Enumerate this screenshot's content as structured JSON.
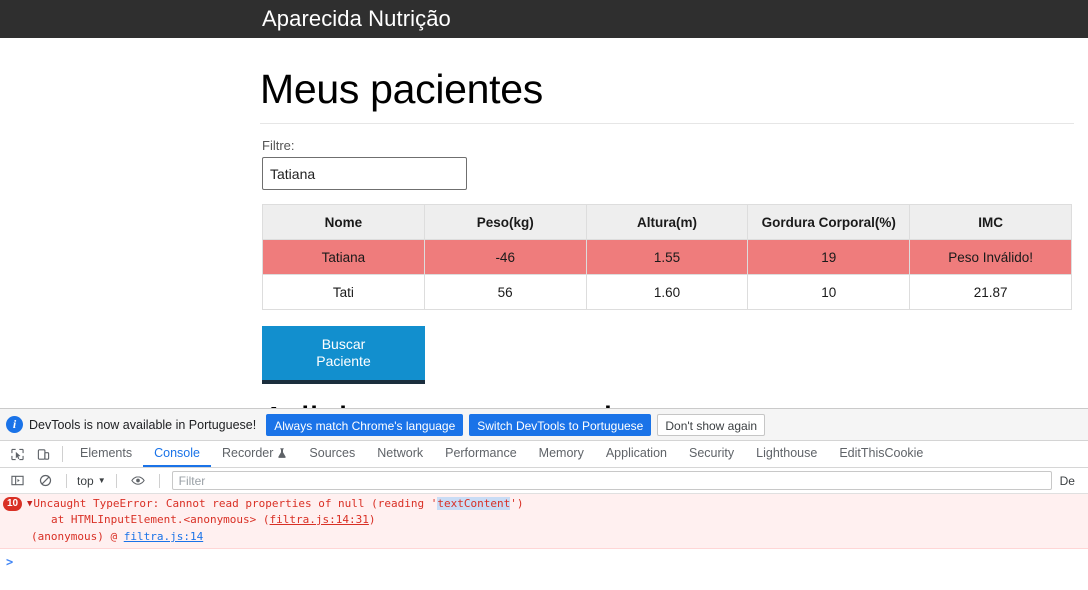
{
  "page": {
    "navbar_brand": "Aparecida Nutrição",
    "title": "Meus pacientes",
    "filter_label": "Filtre:",
    "filter_value": "Tatiana",
    "filter_placeholder": "",
    "table": {
      "headers": [
        "Nome",
        "Peso(kg)",
        "Altura(m)",
        "Gordura Corporal(%)",
        "IMC"
      ],
      "rows": [
        {
          "invalid": true,
          "cells": [
            "Tatiana",
            "-46",
            "1.55",
            "19",
            "Peso Inválido!"
          ]
        },
        {
          "invalid": false,
          "cells": [
            "Tati",
            "56",
            "1.60",
            "10",
            "21.87"
          ]
        }
      ]
    },
    "search_button": "Buscar\nPaciente",
    "search_button_line1": "Buscar",
    "search_button_line2": "Paciente",
    "sub_title": "Adicionar novo paciente",
    "colors": {
      "navbar": "#2f2f2f",
      "button": "#128fce",
      "invalid_row": "#ef7c7c",
      "header_row": "#eeeeee"
    }
  },
  "devtools": {
    "notice": {
      "icon": "info-icon",
      "text": "DevTools is now available in Portuguese!",
      "buttons": [
        {
          "label": "Always match Chrome's language",
          "style": "primary"
        },
        {
          "label": "Switch DevTools to Portuguese",
          "style": "primary"
        },
        {
          "label": "Don't show again",
          "style": "secondary"
        }
      ]
    },
    "tools": {
      "inspect_icon": "inspect-element-icon",
      "device_icon": "device-toolbar-icon"
    },
    "tabs": [
      {
        "label": "Elements",
        "active": false,
        "icon": ""
      },
      {
        "label": "Console",
        "active": true,
        "icon": ""
      },
      {
        "label": "Recorder",
        "active": false,
        "icon": "flask-icon"
      },
      {
        "label": "Sources",
        "active": false,
        "icon": ""
      },
      {
        "label": "Network",
        "active": false,
        "icon": ""
      },
      {
        "label": "Performance",
        "active": false,
        "icon": ""
      },
      {
        "label": "Memory",
        "active": false,
        "icon": ""
      },
      {
        "label": "Application",
        "active": false,
        "icon": ""
      },
      {
        "label": "Security",
        "active": false,
        "icon": ""
      },
      {
        "label": "Lighthouse",
        "active": false,
        "icon": ""
      },
      {
        "label": "EditThisCookie",
        "active": false,
        "icon": ""
      }
    ],
    "console_bar": {
      "sidebar_icon": "console-sidebar-icon",
      "clear_icon": "clear-console-icon",
      "context": "top",
      "context_caret": "▼",
      "eye_icon": "live-expression-icon",
      "filter_placeholder": "Filter",
      "levels_label": "De"
    },
    "console": {
      "error_count": "10",
      "expand_arrow": "▼",
      "message_before": "Uncaught TypeError: Cannot read properties of null (reading '",
      "message_token": "textContent",
      "message_after": "')",
      "stack_prefix": "at HTMLInputElement.<anonymous> (",
      "stack_link": "filtra.js:14:31",
      "stack_suffix": ")",
      "origin_prefix": "(anonymous) @ ",
      "origin_link": "filtra.js:14",
      "prompt": ">"
    }
  }
}
